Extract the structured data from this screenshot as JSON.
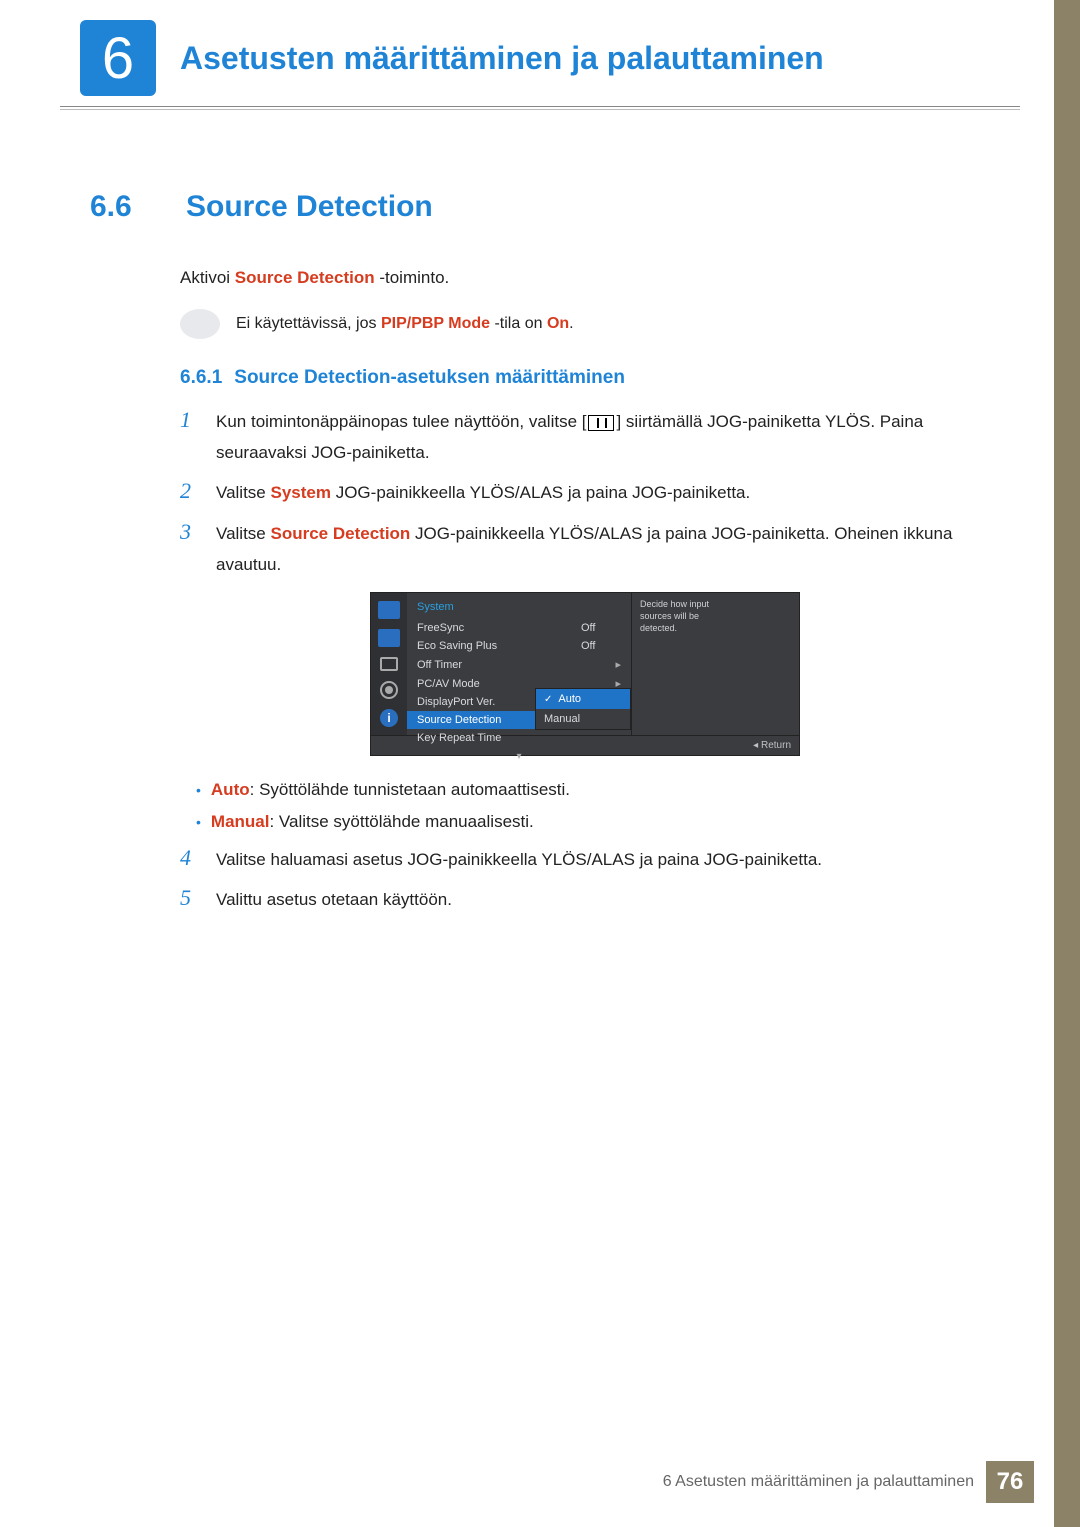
{
  "header": {
    "chapter_number": "6",
    "chapter_title": "Asetusten määrittäminen ja palauttaminen"
  },
  "section": {
    "number": "6.6",
    "title": "Source Detection"
  },
  "intro": {
    "prefix": "Aktivoi ",
    "keyword": "Source Detection",
    "suffix": " -toiminto."
  },
  "note": {
    "prefix": "Ei käytettävissä, jos ",
    "keyword": "PIP/PBP Mode",
    "mid": " -tila on ",
    "keyword2": "On",
    "suffix": "."
  },
  "subsection": {
    "number": "6.6.1",
    "title": "Source Detection-asetuksen määrittäminen"
  },
  "steps": {
    "s1": {
      "num": "1",
      "a": "Kun toimintonäppäinopas tulee näyttöön, valitse [",
      "b": "] siirtämällä JOG-painiketta YLÖS. Paina seuraavaksi JOG-painiketta."
    },
    "s2": {
      "num": "2",
      "a": "Valitse ",
      "kw": "System",
      "b": " JOG-painikkeella YLÖS/ALAS ja paina JOG-painiketta."
    },
    "s3": {
      "num": "3",
      "a": "Valitse ",
      "kw": "Source Detection",
      "b": " JOG-painikkeella YLÖS/ALAS ja paina JOG-painiketta. Oheinen ikkuna avautuu."
    },
    "s4": {
      "num": "4",
      "a": "Valitse haluamasi asetus JOG-painikkeella YLÖS/ALAS ja paina JOG-painiketta."
    },
    "s5": {
      "num": "5",
      "a": "Valittu asetus otetaan käyttöön."
    }
  },
  "osd": {
    "title": "System",
    "desc": "Decide how input sources will be detected.",
    "rows": {
      "r1": {
        "label": "FreeSync",
        "value": "Off"
      },
      "r2": {
        "label": "Eco Saving Plus",
        "value": "Off"
      },
      "r3": {
        "label": "Off Timer",
        "value": "",
        "arrow": "▸"
      },
      "r4": {
        "label": "PC/AV Mode",
        "value": "",
        "arrow": "▸"
      },
      "r5": {
        "label": "DisplayPort Ver.",
        "value": ""
      },
      "r6": {
        "label": "Source Detection",
        "value": ""
      },
      "r7": {
        "label": "Key Repeat Time",
        "value": ""
      }
    },
    "submenu": {
      "opt1": "Auto",
      "opt2": "Manual"
    },
    "return": "Return",
    "info_i": "i"
  },
  "bullets": {
    "b1": {
      "kw": "Auto",
      "text": ": Syöttölähde tunnistetaan automaattisesti."
    },
    "b2": {
      "kw": "Manual",
      "text": ": Valitse syöttölähde manuaalisesti."
    }
  },
  "footer": {
    "text": "6 Asetusten määrittäminen ja palauttaminen",
    "page": "76"
  }
}
